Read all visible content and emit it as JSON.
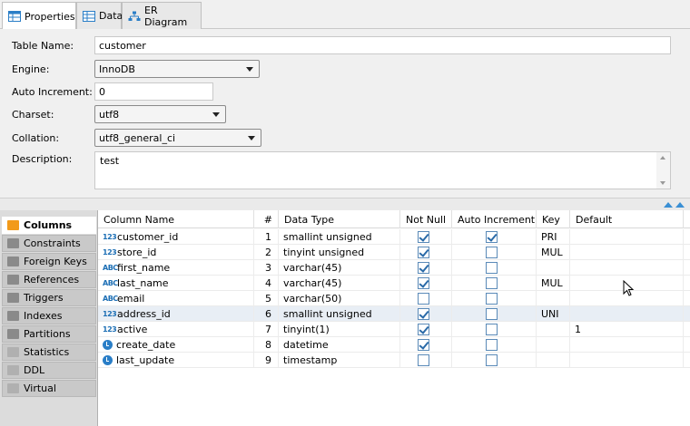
{
  "tabs": [
    {
      "label": "Properties",
      "icon": "table-icon"
    },
    {
      "label": "Data",
      "icon": "grid-icon"
    },
    {
      "label": "ER Diagram",
      "icon": "er-diagram-icon"
    }
  ],
  "form": {
    "table_name_label": "Table Name:",
    "table_name": "customer",
    "engine_label": "Engine:",
    "engine": "InnoDB",
    "auto_increment_label": "Auto Increment:",
    "auto_increment": "0",
    "charset_label": "Charset:",
    "charset": "utf8",
    "collation_label": "Collation:",
    "collation": "utf8_general_ci",
    "description_label": "Description:",
    "description": "test"
  },
  "nav": [
    {
      "label": "Columns",
      "active": true
    },
    {
      "label": "Constraints"
    },
    {
      "label": "Foreign Keys"
    },
    {
      "label": "References"
    },
    {
      "label": "Triggers"
    },
    {
      "label": "Indexes"
    },
    {
      "label": "Partitions"
    },
    {
      "label": "Statistics"
    },
    {
      "label": "DDL"
    },
    {
      "label": "Virtual"
    }
  ],
  "grid": {
    "headers": [
      "Column Name",
      "#",
      "Data Type",
      "Not Null",
      "Auto Increment",
      "Key",
      "Default"
    ],
    "rows": [
      {
        "type_icon": "123",
        "name": "customer_id",
        "num": "1",
        "data_type": "smallint unsigned",
        "not_null": true,
        "auto_inc": true,
        "key": "PRI",
        "default": ""
      },
      {
        "type_icon": "123",
        "name": "store_id",
        "num": "2",
        "data_type": "tinyint unsigned",
        "not_null": true,
        "auto_inc": false,
        "key": "MUL",
        "default": ""
      },
      {
        "type_icon": "ABC",
        "name": "first_name",
        "num": "3",
        "data_type": "varchar(45)",
        "not_null": true,
        "auto_inc": false,
        "key": "",
        "default": ""
      },
      {
        "type_icon": "ABC",
        "name": "last_name",
        "num": "4",
        "data_type": "varchar(45)",
        "not_null": true,
        "auto_inc": false,
        "key": "MUL",
        "default": ""
      },
      {
        "type_icon": "ABC",
        "name": "email",
        "num": "5",
        "data_type": "varchar(50)",
        "not_null": false,
        "auto_inc": false,
        "key": "",
        "default": ""
      },
      {
        "type_icon": "123",
        "name": "address_id",
        "num": "6",
        "data_type": "smallint unsigned",
        "not_null": true,
        "auto_inc": false,
        "key": "UNI",
        "default": ""
      },
      {
        "type_icon": "123",
        "name": "active",
        "num": "7",
        "data_type": "tinyint(1)",
        "not_null": true,
        "auto_inc": false,
        "key": "",
        "default": "1"
      },
      {
        "type_icon": "clock",
        "name": "create_date",
        "num": "8",
        "data_type": "datetime",
        "not_null": true,
        "auto_inc": false,
        "key": "",
        "default": ""
      },
      {
        "type_icon": "clock",
        "name": "last_update",
        "num": "9",
        "data_type": "timestamp",
        "not_null": false,
        "auto_inc": false,
        "key": "",
        "default": ""
      }
    ]
  },
  "colors": {
    "accent": "#2a7ec7",
    "selected_row": "#e8eef5"
  }
}
